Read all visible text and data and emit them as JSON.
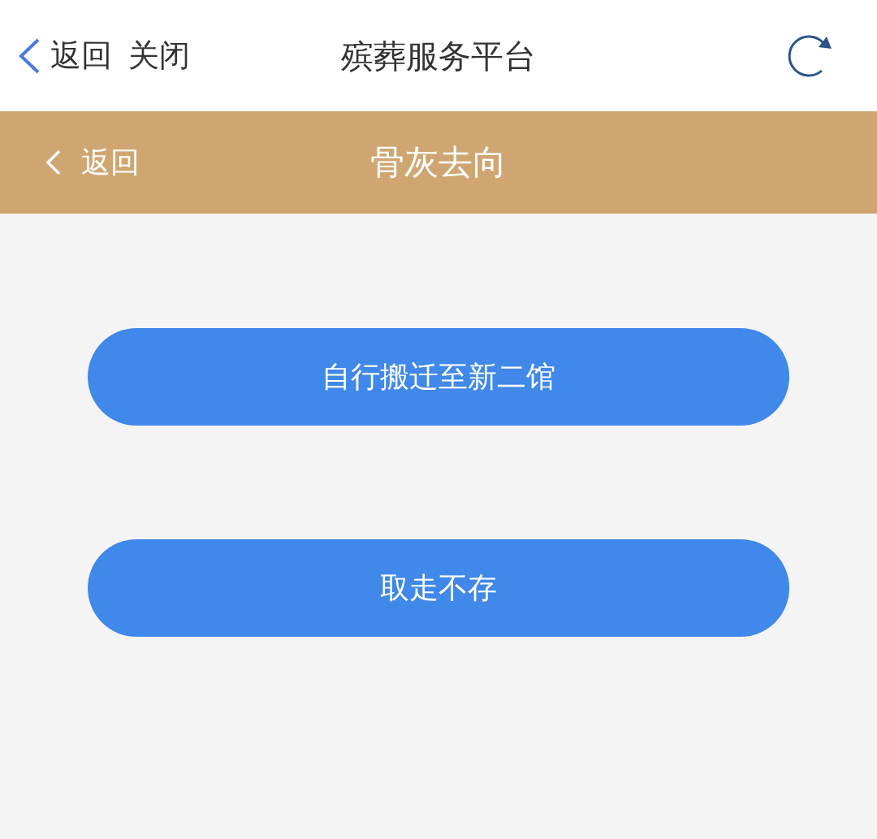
{
  "browser_bar": {
    "back_label": "返回",
    "close_label": "关闭",
    "title": "殡葬服务平台"
  },
  "header": {
    "back_label": "返回",
    "title": "骨灰去向"
  },
  "options": [
    {
      "label": "自行搬迁至新二馆"
    },
    {
      "label": "取走不存"
    }
  ]
}
